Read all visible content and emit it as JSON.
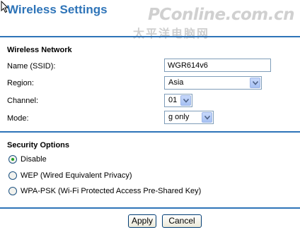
{
  "header": {
    "title": "Wireless Settings",
    "watermark_brand": "PConline.com.cn",
    "watermark_cn": "太平洋电脑网"
  },
  "wireless_network": {
    "heading": "Wireless Network",
    "ssid_label": "Name (SSID):",
    "ssid_value": "WGR614v6",
    "region_label": "Region:",
    "region_value": "Asia",
    "channel_label": "Channel:",
    "channel_value": "01",
    "mode_label": "Mode:",
    "mode_value": "g only"
  },
  "security_options": {
    "heading": "Security Options",
    "options": [
      {
        "label": "Disable",
        "selected": true
      },
      {
        "label": "WEP (Wired Equivalent Privacy)",
        "selected": false
      },
      {
        "label": "WPA-PSK (Wi-Fi Protected Access Pre-Shared Key)",
        "selected": false
      }
    ]
  },
  "actions": {
    "apply_label": "Apply",
    "cancel_label": "Cancel"
  },
  "colors": {
    "accent": "#2e74b8",
    "radio_dot": "#21a121"
  },
  "icons": {
    "cursor": "mouse-pointer-icon",
    "dropdown": "chevron-down-icon"
  }
}
